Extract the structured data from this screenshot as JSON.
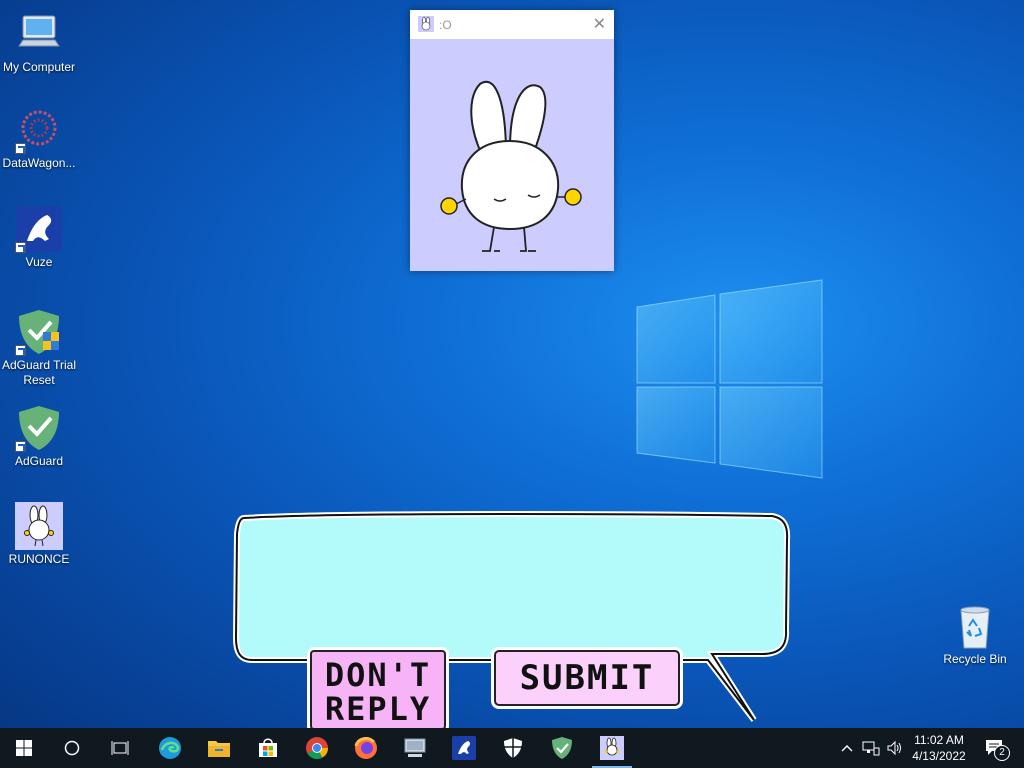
{
  "desktop": {
    "icons": [
      {
        "label": "My Computer",
        "icon": "computer-icon"
      },
      {
        "label": "DataWagon...",
        "icon": "datawagon-icon"
      },
      {
        "label": "Vuze",
        "icon": "vuze-frog-icon"
      },
      {
        "label": "AdGuard Trial Reset",
        "icon": "adguard-shield-uac-icon"
      },
      {
        "label": "AdGuard",
        "icon": "adguard-shield-icon"
      },
      {
        "label": "RUNONCE",
        "icon": "bunny-icon"
      }
    ],
    "recycle_bin": {
      "label": "Recycle Bin",
      "icon": "recycle-bin-icon"
    }
  },
  "bunny_window": {
    "title": ":O",
    "icon": "bunny-icon",
    "close_glyph": "✕",
    "background": "#ccccff"
  },
  "reply_dialog": {
    "input_value": "",
    "dont_reply_label_line1": "DON'T",
    "dont_reply_label_line2": "REPLY",
    "submit_label": "SUBMIT",
    "bubble_color": "#b3fbfb",
    "button_color": "#f6b3f6"
  },
  "taskbar": {
    "items": [
      {
        "name": "start",
        "icon": "windows-start-icon"
      },
      {
        "name": "search",
        "icon": "search-circle-icon"
      },
      {
        "name": "task-view",
        "icon": "task-view-icon"
      },
      {
        "name": "edge",
        "icon": "edge-icon"
      },
      {
        "name": "file-explorer",
        "icon": "folder-icon"
      },
      {
        "name": "store",
        "icon": "store-icon"
      },
      {
        "name": "chrome",
        "icon": "chrome-icon"
      },
      {
        "name": "firefox",
        "icon": "firefox-icon"
      },
      {
        "name": "computer",
        "icon": "computer-icon"
      },
      {
        "name": "vuze",
        "icon": "vuze-frog-icon"
      },
      {
        "name": "defender",
        "icon": "shield-icon"
      },
      {
        "name": "adguard",
        "icon": "adguard-shield-icon"
      },
      {
        "name": "bunny-app",
        "icon": "bunny-icon",
        "active": true
      }
    ],
    "tray": {
      "time": "11:02 AM",
      "date": "4/13/2022",
      "notification_count": "2"
    }
  }
}
